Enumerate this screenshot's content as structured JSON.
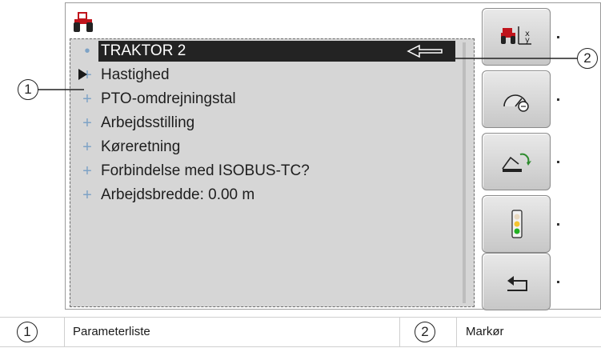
{
  "list": {
    "items": [
      {
        "bullet": "•",
        "label": "TRAKTOR 2",
        "selected": true
      },
      {
        "bullet": "+",
        "label": "Hastighed"
      },
      {
        "bullet": "+",
        "label": "PTO-omdrejningstal"
      },
      {
        "bullet": "+",
        "label": "Arbejdsstilling"
      },
      {
        "bullet": "+",
        "label": "Køreretning"
      },
      {
        "bullet": "+",
        "label": "Forbindelse med ISOBUS-TC?"
      },
      {
        "bullet": "+",
        "label": "Arbejdsbredde: 0.00 m"
      }
    ]
  },
  "sidebar": {
    "buttons": [
      {
        "icon": "tractor-xy-icon"
      },
      {
        "icon": "speedometer-icon"
      },
      {
        "icon": "pto-icon"
      },
      {
        "icon": "traffic-light-icon"
      },
      {
        "icon": "back-icon"
      }
    ]
  },
  "callouts": {
    "one": "1",
    "two": "2"
  },
  "legend": {
    "items": [
      {
        "number": "1",
        "text": "Parameterliste"
      },
      {
        "number": "2",
        "text": "Markør"
      }
    ]
  },
  "colors": {
    "tractor_red": "#c0141c",
    "selection": "#232323",
    "panel": "#d6d6d6",
    "bullet": "#7ea3c6"
  }
}
